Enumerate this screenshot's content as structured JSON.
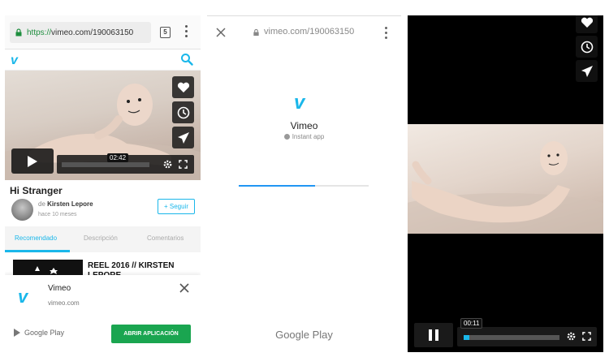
{
  "panel1": {
    "url_scheme": "https://",
    "url_rest": "vimeo.com/190063150",
    "tab_count": "5",
    "site_logo": "v",
    "player": {
      "current_time": "02:42"
    },
    "video_title": "Hi Stranger",
    "author_prefix": "de ",
    "author_name": "Kirsten Lepore",
    "posted_ago": "hace 10 meses",
    "follow_label": "+ Seguir",
    "tabs": [
      "Recomendado",
      "Descripción",
      "Comentarios"
    ],
    "related_title": "REEL 2016 // KIRSTEN LEPORE",
    "banner": {
      "logo": "v",
      "app_name": "Vimeo",
      "app_url": "vimeo.com",
      "store_label": "Google Play",
      "open_label": "ABRIR APLICACIÓN"
    }
  },
  "panel2": {
    "url": "vimeo.com/190063150",
    "logo": "v",
    "app_name": "Vimeo",
    "instant_label": "Instant app",
    "load_progress": 0.59,
    "footer": "Google Play"
  },
  "panel3": {
    "current_time": "00:11",
    "progress": 0.06
  },
  "colors": {
    "brand": "#1ab7ea",
    "play_store_green": "#1aa550",
    "loader_blue": "#2196f3"
  }
}
